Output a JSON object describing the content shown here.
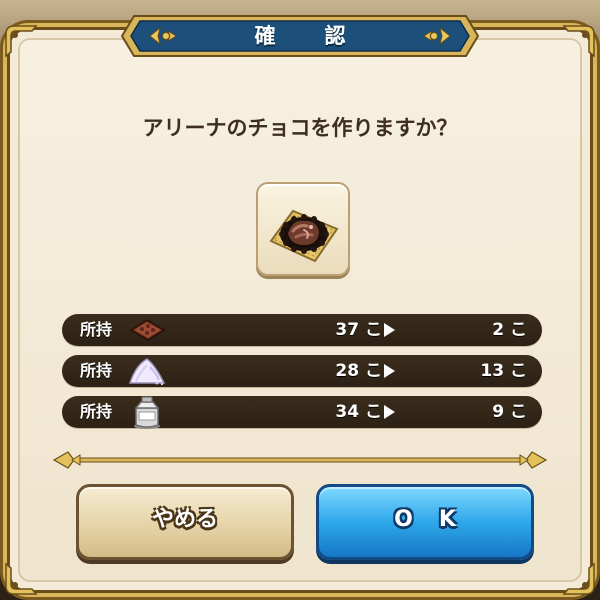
{
  "dialog": {
    "title": "確　認",
    "question": "アリーナのチョコを作りますか？",
    "item_icon": "chocolate-icon"
  },
  "materials": [
    {
      "label": "所持",
      "icon": "cacao-material-icon",
      "have": "37 こ",
      "after": "2 こ"
    },
    {
      "label": "所持",
      "icon": "sugar-material-icon",
      "have": "28 こ",
      "after": "13 こ"
    },
    {
      "label": "所持",
      "icon": "milk-can-material-icon",
      "have": "34 こ",
      "after": "9 こ"
    }
  ],
  "buttons": {
    "cancel": "やめる",
    "ok": "OK"
  },
  "colors": {
    "title_plate": "#1c4f7a",
    "ok_button": "#2fa7ea",
    "cancel_button": "#e6d3a8",
    "frame_gold": "#d8b659",
    "row_background": "#33271a"
  }
}
